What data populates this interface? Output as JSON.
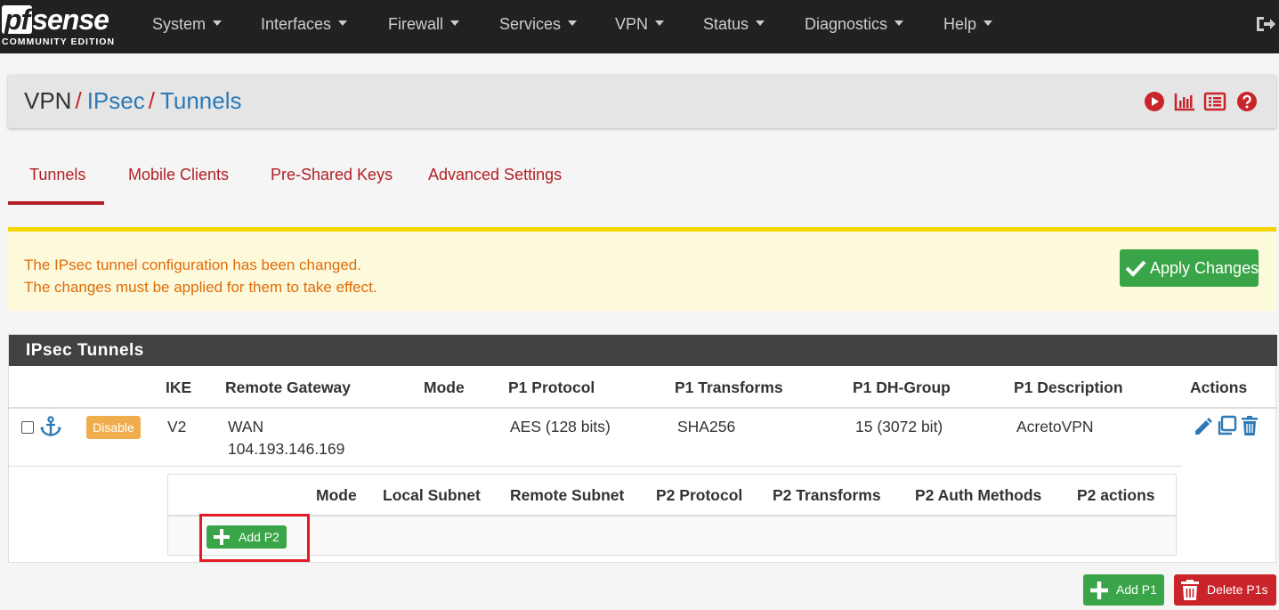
{
  "brand": {
    "logo_pf": "pf",
    "logo_sense": "sense",
    "edition": "COMMUNITY EDITION"
  },
  "nav": [
    {
      "label": "System"
    },
    {
      "label": "Interfaces"
    },
    {
      "label": "Firewall"
    },
    {
      "label": "Services"
    },
    {
      "label": "VPN"
    },
    {
      "label": "Status"
    },
    {
      "label": "Diagnostics"
    },
    {
      "label": "Help"
    }
  ],
  "breadcrumb": {
    "root": "VPN",
    "sep": "/",
    "level1": "IPsec",
    "level2": "Tunnels"
  },
  "tabs": [
    {
      "label": "Tunnels",
      "active": true
    },
    {
      "label": "Mobile Clients"
    },
    {
      "label": "Pre-Shared Keys"
    },
    {
      "label": "Advanced Settings"
    }
  ],
  "alert": {
    "line1": "The IPsec tunnel configuration has been changed.",
    "line2": "The changes must be applied for them to take effect.",
    "apply_label": "Apply Changes"
  },
  "tunnels": {
    "title": "IPsec Tunnels",
    "headers": {
      "ike": "IKE",
      "remote_gateway": "Remote Gateway",
      "mode": "Mode",
      "p1_protocol": "P1 Protocol",
      "p1_transforms": "P1 Transforms",
      "p1_dh_group": "P1 DH-Group",
      "p1_description": "P1 Description",
      "actions": "Actions"
    },
    "row": {
      "disable_label": "Disable",
      "ike": "V2",
      "gateway_iface": "WAN",
      "gateway_ip": "104.193.146.169",
      "p1_protocol": "AES (128 bits)",
      "p1_transforms": "SHA256",
      "p1_dh_group": "15 (3072 bit)",
      "p1_description": "AcretoVPN"
    },
    "p2_headers": {
      "mode": "Mode",
      "local_subnet": "Local Subnet",
      "remote_subnet": "Remote Subnet",
      "p2_protocol": "P2 Protocol",
      "p2_transforms": "P2 Transforms",
      "p2_auth": "P2 Auth Methods",
      "p2_actions": "P2 actions"
    },
    "add_p2_label": "Add P2"
  },
  "buttons": {
    "add_p1": "Add P1",
    "delete_p1s": "Delete P1s"
  },
  "colors": {
    "brand_red": "#b21f24",
    "link_blue": "#2d79b5",
    "success": "#3aa548",
    "warning": "#f0ad4e",
    "danger": "#c9242a",
    "highlight": "#e31b23"
  }
}
